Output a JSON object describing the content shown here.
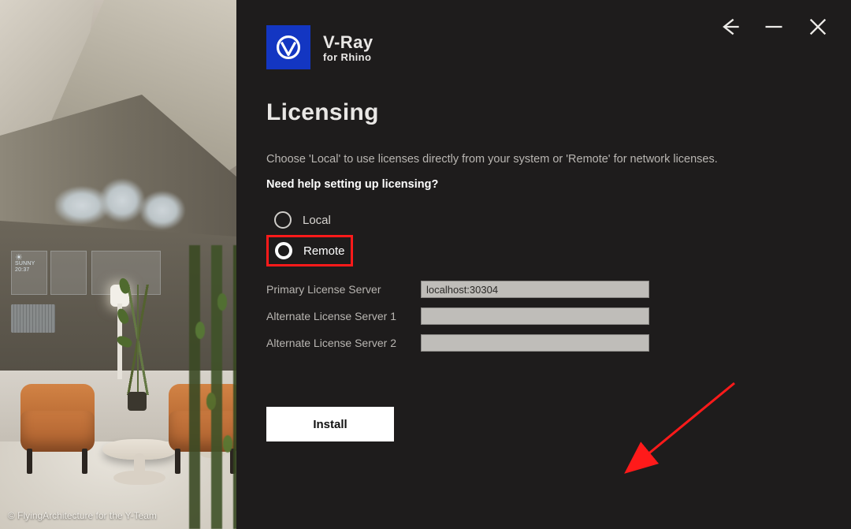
{
  "brand": {
    "line1": "V-Ray",
    "line2": "for Rhino"
  },
  "titlebar": {
    "back": "Back",
    "minimize": "Minimize",
    "close": "Close"
  },
  "page": {
    "title": "Licensing",
    "description": "Choose 'Local' to use licenses directly from your system or 'Remote' for network licenses.",
    "help_link": "Need help setting up licensing?"
  },
  "options": {
    "local": {
      "label": "Local",
      "selected": false
    },
    "remote": {
      "label": "Remote",
      "selected": true,
      "highlighted": true
    }
  },
  "fields": {
    "primary": {
      "label": "Primary License Server",
      "value": "localhost:30304"
    },
    "alt1": {
      "label": "Alternate License Server 1",
      "value": ""
    },
    "alt2": {
      "label": "Alternate License Server 2",
      "value": ""
    }
  },
  "actions": {
    "install": "Install"
  },
  "sidebar": {
    "credit": "© FlyingArchitecture for the Y-Team",
    "hud": {
      "weather": "SUNNY",
      "time": "20:37"
    }
  },
  "annotation": {
    "arrow_color": "#ff1a1a"
  }
}
